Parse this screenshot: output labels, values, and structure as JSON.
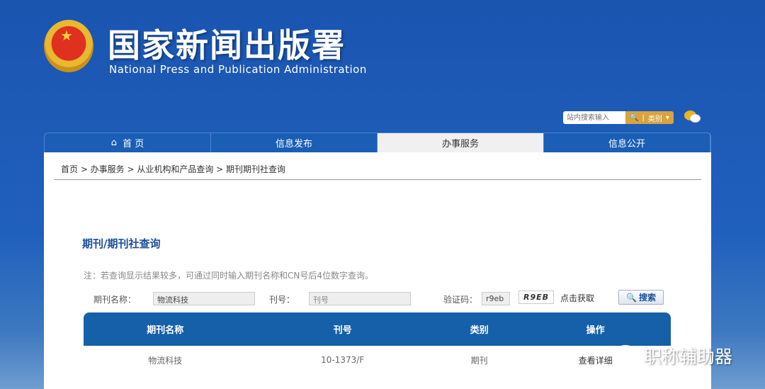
{
  "header": {
    "title_cn": "国家新闻出版署",
    "title_en": "National  Press and Publication Administration"
  },
  "search": {
    "placeholder": "站内搜索输入",
    "category": "类别"
  },
  "nav": [
    {
      "label": "首 页"
    },
    {
      "label": "信息发布"
    },
    {
      "label": "办事服务"
    },
    {
      "label": "信息公开"
    }
  ],
  "breadcrumb": "首页 > 办事服务 > 从业机构和产品查询 > 期刊期刊社查询",
  "page_title": "期刊/期刊社查询",
  "note": "注：若查询显示结果较多，可通过同时输入期刊名称和CN号后4位数字查询。",
  "form": {
    "name_label": "期刊名称：",
    "name_value": "物流科技",
    "issn_label": "刊号：",
    "issn_placeholder": "刊号",
    "captcha_label": "验证码：",
    "captcha_value": "r9eb",
    "captcha_image": "R9EB",
    "refresh": "点击获取",
    "search_btn": "搜索"
  },
  "table": {
    "headers": [
      "期刊名称",
      "刊号",
      "类别",
      "操作"
    ],
    "rows": [
      [
        "物流科技",
        "10-1373/F",
        "期刊",
        "查看详细"
      ]
    ]
  },
  "watermark": "职称辅助器"
}
